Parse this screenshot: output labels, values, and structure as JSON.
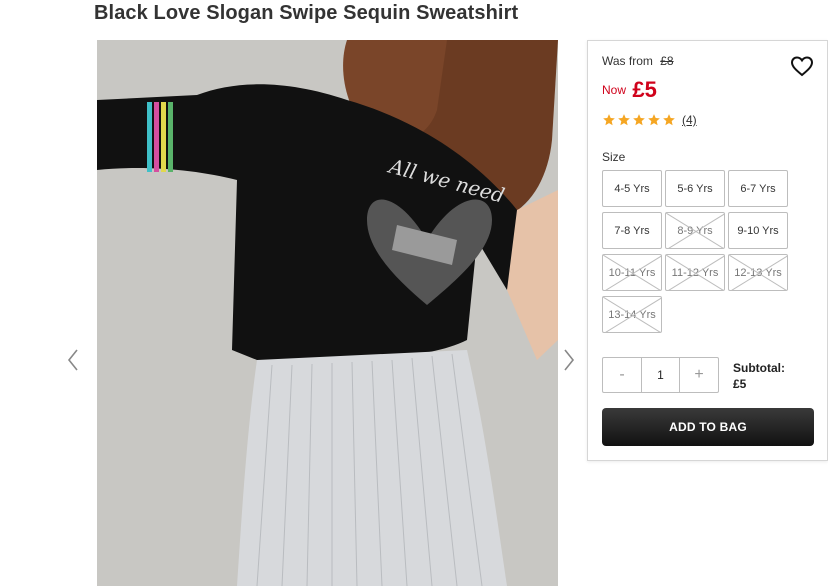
{
  "product": {
    "title": "Black Love Slogan Swipe Sequin Sweatshirt",
    "image_alt": "product-photo"
  },
  "pricing": {
    "was_label": "Was from",
    "was_price": "£8",
    "now_label": "Now",
    "now_price": "£5",
    "price_color": "#d0021b"
  },
  "rating": {
    "stars": 5,
    "max": 5,
    "count_label": "(4)",
    "star_color": "#f5a623"
  },
  "size": {
    "label": "Size",
    "options": [
      {
        "label": "4-5 Yrs",
        "available": true
      },
      {
        "label": "5-6 Yrs",
        "available": true
      },
      {
        "label": "6-7 Yrs",
        "available": true
      },
      {
        "label": "7-8 Yrs",
        "available": true
      },
      {
        "label": "8-9 Yrs",
        "available": false
      },
      {
        "label": "9-10 Yrs",
        "available": true
      },
      {
        "label": "10-11 Yrs",
        "available": false
      },
      {
        "label": "11-12 Yrs",
        "available": false
      },
      {
        "label": "12-13 Yrs",
        "available": false
      },
      {
        "label": "13-14 Yrs",
        "available": false
      }
    ]
  },
  "quantity": {
    "minus": "-",
    "value": "1",
    "plus": "+"
  },
  "subtotal": {
    "label": "Subtotal:",
    "value": "£5"
  },
  "cta": {
    "add_to_bag": "ADD TO BAG"
  },
  "icons": {
    "wishlist": "heart-outline-icon",
    "prev": "chevron-left-icon",
    "next": "chevron-right-icon"
  }
}
